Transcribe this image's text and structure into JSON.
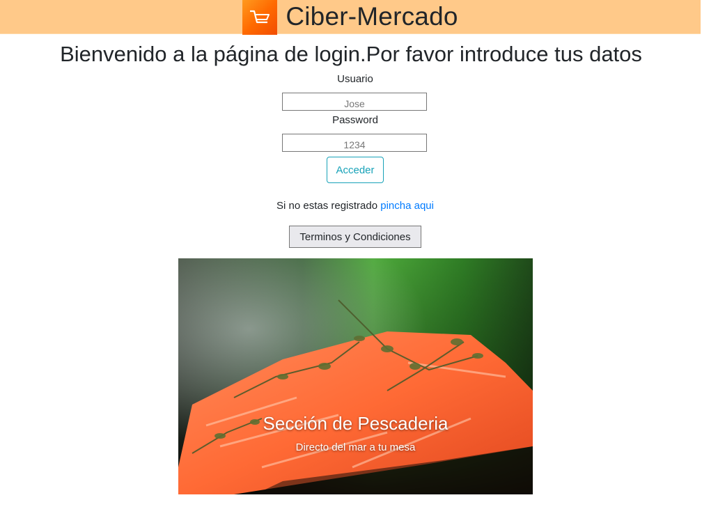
{
  "header": {
    "title": "Ciber-Mercado",
    "logo_icon": "shopping-cart-icon",
    "background": "#ffc989"
  },
  "login": {
    "welcome": "Bienvenido a la página de login.Por favor introduce tus datos",
    "usuario_label": "Usuario",
    "usuario_placeholder": "Jose",
    "password_label": "Password",
    "password_placeholder": "1234",
    "submit_label": "Acceder",
    "register_text": "Si no estas registrado ",
    "register_link": "pincha aqui",
    "terms_label": "Terminos y Condiciones"
  },
  "carousel": {
    "slide_title": "Sección de Pescaderia",
    "slide_subtitle": "Directo del mar a tu mesa"
  },
  "colors": {
    "accent": "#17a2b8",
    "link": "#007bff",
    "logo": "#ff6a00"
  }
}
